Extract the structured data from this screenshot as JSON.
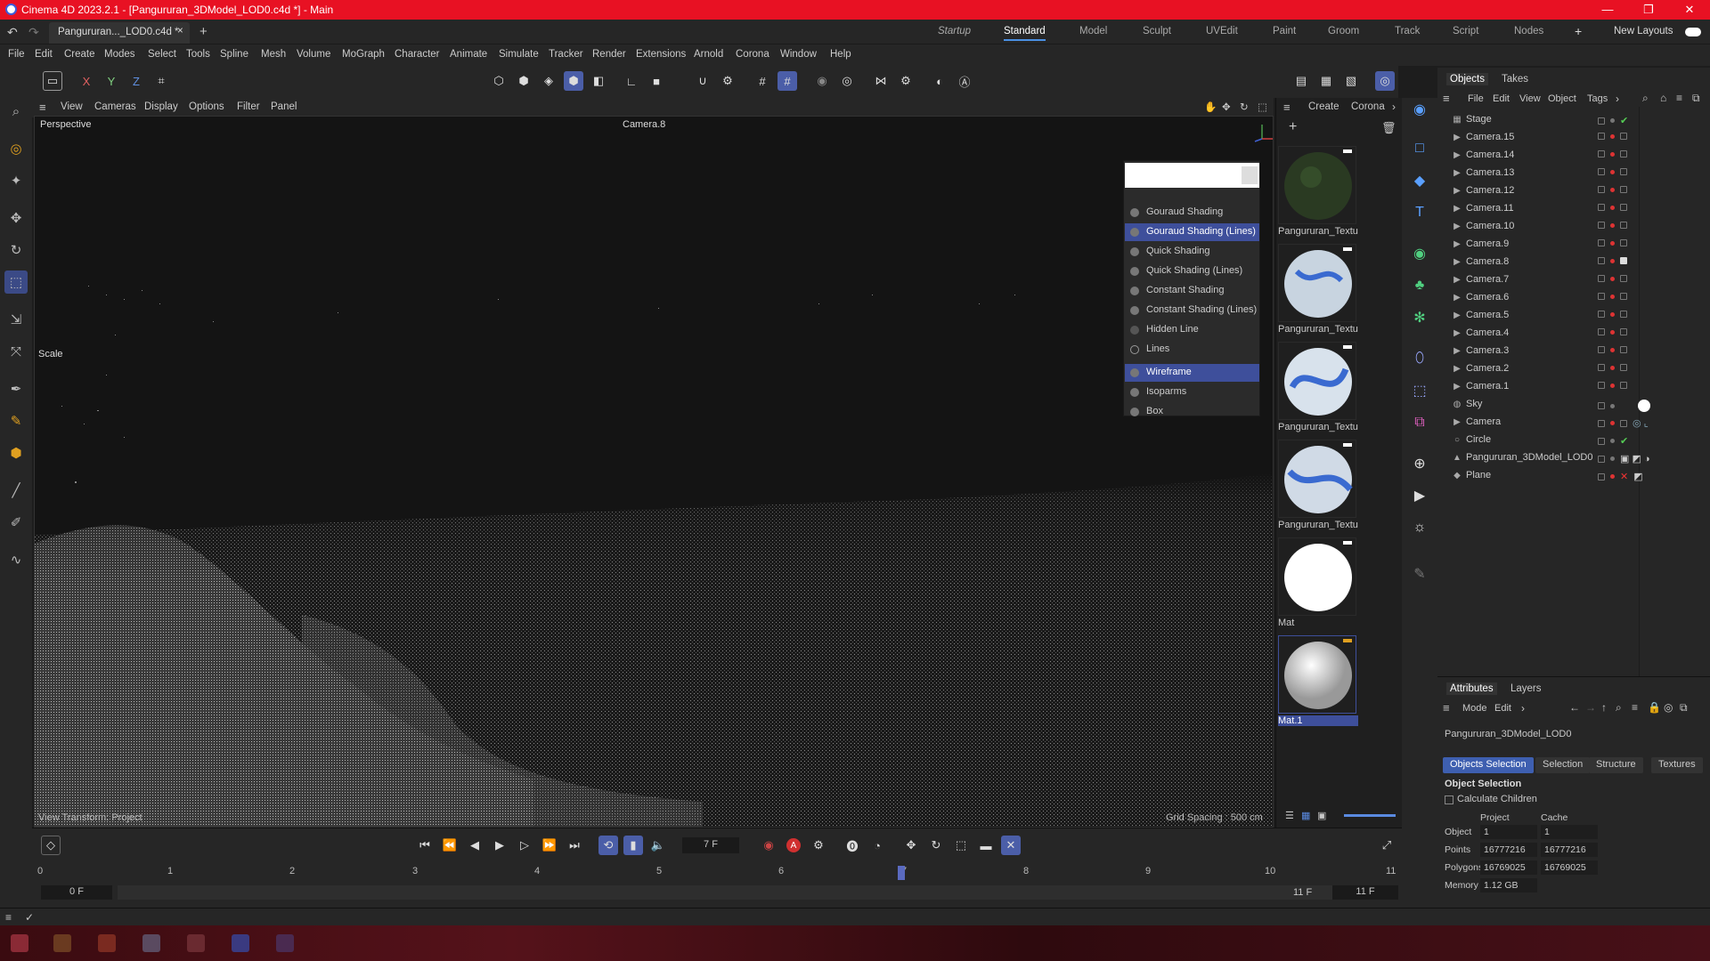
{
  "window": {
    "title": "Cinema 4D 2023.2.1 - [Pangururan_3DModel_LOD0.c4d *] - Main",
    "controls": [
      "—",
      "❐",
      "✕"
    ]
  },
  "document_tab": {
    "label": "Pangururan..._LOD0.c4d *",
    "close": "×",
    "add": "+"
  },
  "layouts": {
    "items": [
      "Startup",
      "Standard",
      "Model",
      "Sculpt",
      "UVEdit",
      "Paint",
      "Groom",
      "Track",
      "Script",
      "Nodes"
    ],
    "active": "Standard",
    "add": "+",
    "new_layouts": "New Layouts"
  },
  "menubar": [
    "File",
    "Edit",
    "Create",
    "Modes",
    "Select",
    "Tools",
    "Spline",
    "Mesh",
    "Volume",
    "MoGraph",
    "Character",
    "Animate",
    "Simulate",
    "Tracker",
    "Render",
    "Extensions",
    "Arnold",
    "Corona",
    "Window",
    "Help"
  ],
  "axis_buttons": [
    "X",
    "Y",
    "Z"
  ],
  "viewport_menu": [
    "View",
    "Cameras",
    "Display",
    "Options",
    "Filter",
    "Panel"
  ],
  "viewport": {
    "name": "Perspective",
    "camera": "Camera.8",
    "scale_label": "Scale",
    "view_transform": "View Transform: Project",
    "grid_spacing": "Grid Spacing : 500 cm"
  },
  "shading_menu": {
    "items": [
      "Gouraud Shading",
      "Gouraud Shading (Lines)",
      "Quick Shading",
      "Quick Shading (Lines)",
      "Constant Shading",
      "Constant Shading (Lines)",
      "Hidden Line",
      "Lines",
      "Wireframe",
      "Isoparms",
      "Box"
    ],
    "selected": [
      "Gouraud Shading (Lines)",
      "Wireframe"
    ]
  },
  "material_panel": {
    "menu": [
      "Create",
      "Corona"
    ],
    "materials": [
      {
        "name": "Pangururan_Textu",
        "color": "#2a3a22"
      },
      {
        "name": "Pangururan_Textu",
        "color": "#c8d4e0"
      },
      {
        "name": "Pangururan_Textu",
        "color": "#d8e2ec"
      },
      {
        "name": "Pangururan_Textu",
        "color": "#d0dae6"
      },
      {
        "name": "Mat",
        "color": "#ffffff"
      },
      {
        "name": "Mat.1",
        "color": "#e8e8e8"
      }
    ]
  },
  "objects_panel": {
    "tabs": [
      "Objects",
      "Takes"
    ],
    "menu": [
      "File",
      "Edit",
      "View",
      "Object",
      "Tags"
    ],
    "items": [
      {
        "name": "Stage",
        "icon": "stage-icon"
      },
      {
        "name": "Camera.15",
        "icon": "camera-icon"
      },
      {
        "name": "Camera.14",
        "icon": "camera-icon"
      },
      {
        "name": "Camera.13",
        "icon": "camera-icon"
      },
      {
        "name": "Camera.12",
        "icon": "camera-icon"
      },
      {
        "name": "Camera.11",
        "icon": "camera-icon"
      },
      {
        "name": "Camera.10",
        "icon": "camera-icon"
      },
      {
        "name": "Camera.9",
        "icon": "camera-icon"
      },
      {
        "name": "Camera.8",
        "icon": "camera-icon"
      },
      {
        "name": "Camera.7",
        "icon": "camera-icon"
      },
      {
        "name": "Camera.6",
        "icon": "camera-icon"
      },
      {
        "name": "Camera.5",
        "icon": "camera-icon"
      },
      {
        "name": "Camera.4",
        "icon": "camera-icon"
      },
      {
        "name": "Camera.3",
        "icon": "camera-icon"
      },
      {
        "name": "Camera.2",
        "icon": "camera-icon"
      },
      {
        "name": "Camera.1",
        "icon": "camera-icon"
      },
      {
        "name": "Sky",
        "icon": "sky-icon"
      },
      {
        "name": "Camera",
        "icon": "camera-icon"
      },
      {
        "name": "Circle",
        "icon": "circle-icon"
      },
      {
        "name": "Pangururan_3DModel_LOD0",
        "icon": "polygon-icon"
      },
      {
        "name": "Plane",
        "icon": "plane-icon"
      }
    ]
  },
  "attributes_panel": {
    "tabs": [
      "Attributes",
      "Layers"
    ],
    "menu": [
      "Mode",
      "Edit"
    ],
    "object_name": "Pangururan_3DModel_LOD0",
    "sub_tabs": [
      "Objects Selection",
      "Selection",
      "Structure",
      "Textures"
    ],
    "section": "Object Selection",
    "calculate_children": "Calculate Children",
    "table": {
      "headers": [
        "Project",
        "Cache"
      ],
      "rows": [
        {
          "label": "Object",
          "project": "1",
          "cache": "1"
        },
        {
          "label": "Points",
          "project": "16777216",
          "cache": "16777216"
        },
        {
          "label": "Polygons",
          "project": "16769025",
          "cache": "16769025"
        },
        {
          "label": "Memory",
          "project": "1.12 GB",
          "cache": ""
        }
      ]
    }
  },
  "timeline": {
    "current_frame": "7 F",
    "ticks": [
      "0",
      "1",
      "2",
      "3",
      "4",
      "5",
      "6",
      "7",
      "8",
      "9",
      "10",
      "11"
    ],
    "start": "0 F",
    "start2": "0 F",
    "end": "11 F",
    "end2": "11 F",
    "playhead_frame": 7
  },
  "colors": {
    "titlebar": "#e81123",
    "accent": "#4b5ea8",
    "panel": "#262626",
    "viewport": "#141414"
  }
}
